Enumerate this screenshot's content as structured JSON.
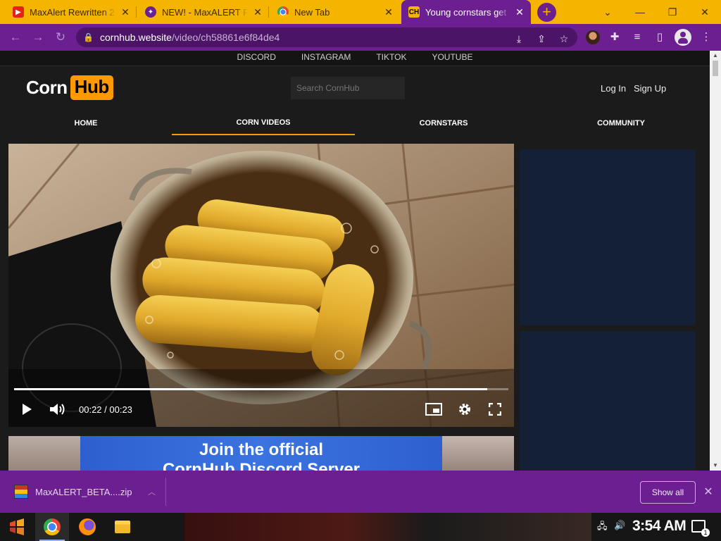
{
  "browser": {
    "tabs": [
      {
        "title": "MaxAlert Rewritten 2",
        "icon": "youtube-icon"
      },
      {
        "title": "NEW! - MaxALERT R",
        "icon": "maxalert-icon"
      },
      {
        "title": "New Tab",
        "icon": "chrome-icon"
      },
      {
        "title": "Young cornstars get h",
        "icon": "cornhub-icon",
        "active": true
      }
    ],
    "new_tab_label": "+",
    "url_host": "cornhub.website",
    "url_path": "/video/ch58861e6f84de4"
  },
  "site": {
    "social_links": [
      "DISCORD",
      "INSTAGRAM",
      "TIKTOK",
      "YOUTUBE"
    ],
    "logo_left": "Corn",
    "logo_right": "Hub",
    "search_placeholder": "Search CornHub",
    "login_label": "Log In",
    "signup_label": "Sign Up",
    "nav": [
      {
        "label": "HOME"
      },
      {
        "label": "CORN VIDEOS",
        "active": true
      },
      {
        "label": "CORNSTARS"
      },
      {
        "label": "COMMUNITY"
      }
    ]
  },
  "player": {
    "current_time": "00:22",
    "duration": "00:23",
    "time_display": "00:22 / 00:23",
    "progress": 0.957
  },
  "banner": {
    "line1": "Join the official",
    "line2": "CornHub Discord Server"
  },
  "download_bar": {
    "file_name": "MaxALERT_BETA....zip",
    "show_all_label": "Show all"
  },
  "taskbar": {
    "clock": "3:54 AM",
    "notification_count": "1"
  },
  "colors": {
    "tabstrip": "#f5b400",
    "toolbar": "#6b1f91",
    "accent": "#ff9900",
    "page_bg": "#1b1b1b",
    "ad_bg": "#142036"
  }
}
